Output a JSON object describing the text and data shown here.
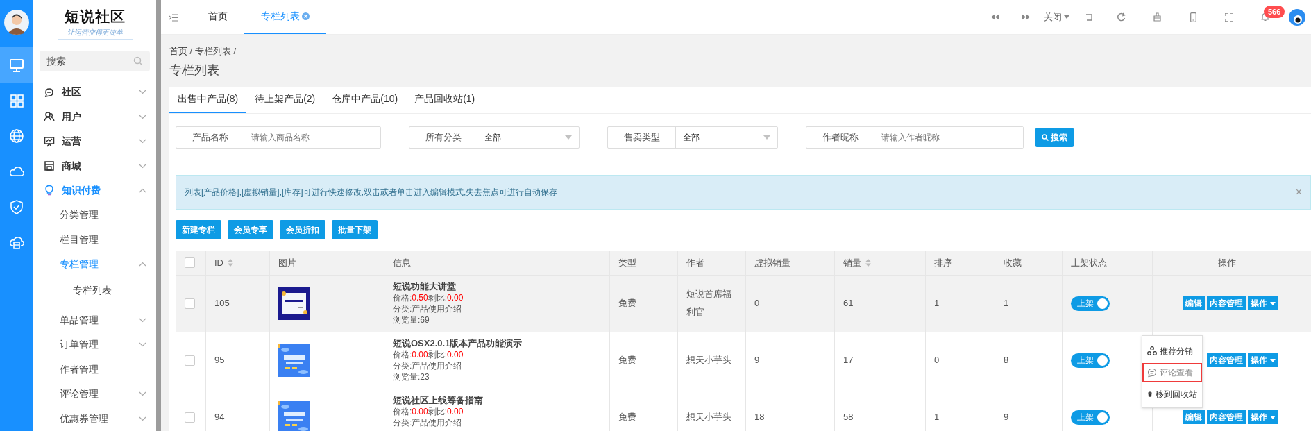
{
  "rail": {
    "items": [
      {
        "kind": "monitor",
        "selected": true
      },
      {
        "kind": "grid",
        "selected": false
      },
      {
        "kind": "globe",
        "selected": false
      },
      {
        "kind": "cloud",
        "selected": false
      },
      {
        "kind": "shield",
        "selected": false
      },
      {
        "kind": "storage",
        "selected": false
      }
    ]
  },
  "sidebar": {
    "logo": "短说社区",
    "slogan": "让运营变得更简单",
    "search": {
      "placeholder": "搜索"
    },
    "items": [
      {
        "kind": "chat",
        "label": "社区",
        "expanded": false,
        "selected": false
      },
      {
        "kind": "users",
        "label": "用户",
        "expanded": false,
        "selected": false
      },
      {
        "kind": "board",
        "label": "运营",
        "expanded": false,
        "selected": false
      },
      {
        "kind": "store",
        "label": "商城",
        "expanded": false,
        "selected": false
      },
      {
        "kind": "bulb",
        "label": "知识付费",
        "expanded": true,
        "selected": true,
        "children": [
          {
            "label": "分类管理",
            "selected": false
          },
          {
            "label": "栏目管理",
            "selected": false
          },
          {
            "label": "专栏管理",
            "expanded": true,
            "selected": true,
            "children": [
              {
                "label": "专栏列表",
                "selected": false
              }
            ]
          },
          {
            "label": "单品管理",
            "expanded": false,
            "selected": false
          },
          {
            "label": "订单管理",
            "expanded": false,
            "selected": false
          },
          {
            "label": "作者管理",
            "selected": false
          },
          {
            "label": "评论管理",
            "expanded": false,
            "selected": false
          },
          {
            "label": "优惠券管理",
            "expanded": false,
            "selected": false
          }
        ]
      }
    ]
  },
  "topbar": {
    "tabs": [
      {
        "label": "首页",
        "selected": false,
        "closable": false
      },
      {
        "label": "专栏列表",
        "selected": true,
        "closable": true
      }
    ],
    "close_menu": "关闭",
    "notification_count": "566"
  },
  "breadcrumb": {
    "items": [
      "首页",
      "专栏列表"
    ],
    "separator": "/"
  },
  "page_title": "专栏列表",
  "product_tabs": [
    {
      "label": "出售中产品(8)",
      "selected": true
    },
    {
      "label": "待上架产品(2)",
      "selected": false
    },
    {
      "label": "仓库中产品(10)",
      "selected": false
    },
    {
      "label": "产品回收站(1)",
      "selected": false
    }
  ],
  "filters": [
    {
      "kind": "text",
      "label": "产品名称",
      "placeholder": "请输入商品名称"
    },
    {
      "kind": "select",
      "label": "所有分类",
      "value": "全部"
    },
    {
      "kind": "select",
      "label": "售卖类型",
      "value": "全部"
    },
    {
      "kind": "text",
      "label": "作者昵称",
      "placeholder": "请输入作者昵称"
    }
  ],
  "search_button": "搜索",
  "alert": {
    "text": "列表[产品价格],[虚拟销量],[库存]可进行快速修改,双击或者单击进入编辑模式,失去焦点可进行自动保存",
    "close": "×"
  },
  "action_buttons": [
    "新建专栏",
    "会员专享",
    "会员折扣",
    "批量下架"
  ],
  "table": {
    "header_checked": false,
    "columns": [
      {
        "label": "ID",
        "sortable": true
      },
      {
        "label": "图片",
        "sortable": false
      },
      {
        "label": "信息",
        "sortable": false
      },
      {
        "label": "类型",
        "sortable": false
      },
      {
        "label": "作者",
        "sortable": false
      },
      {
        "label": "虚拟销量",
        "sortable": false
      },
      {
        "label": "销量",
        "sortable": true
      },
      {
        "label": "排序",
        "sortable": false
      },
      {
        "label": "收藏",
        "sortable": false
      },
      {
        "label": "上架状态",
        "sortable": false
      },
      {
        "label": "操作",
        "sortable": false
      }
    ],
    "rows": [
      {
        "checked": false,
        "hovered": true,
        "id": "105",
        "title": "短说功能大讲堂",
        "price_label": "价格:",
        "price": "0.50",
        "ratio_label": "剥比:",
        "ratio": "0.00",
        "category": "分类:产品使用介绍",
        "views": "浏览量:69",
        "type": "免费",
        "author": "短说首席福利官",
        "virtual_sales": "0",
        "sales": "61",
        "sort": "1",
        "favorites": "1",
        "shelf": {
          "label": "上架",
          "on": true
        },
        "actions": [
          {
            "kind": "button",
            "label": "编辑"
          },
          {
            "kind": "button",
            "label": "内容管理"
          },
          {
            "kind": "dropdown",
            "label": "操作"
          }
        ]
      },
      {
        "checked": false,
        "hovered": false,
        "id": "95",
        "title": "短说OSX2.0.1版本产品功能演示",
        "price_label": "价格:",
        "price": "0.00",
        "ratio_label": "剥比:",
        "ratio": "0.00",
        "category": "分类:产品使用介绍",
        "views": "浏览量:23",
        "type": "免费",
        "author": "想天小芋头",
        "virtual_sales": "9",
        "sales": "17",
        "sort": "0",
        "favorites": "8",
        "shelf": {
          "label": "上架",
          "on": true
        },
        "actions": [
          {
            "kind": "button",
            "label": "内容管理"
          },
          {
            "kind": "dropdown",
            "label": "操作"
          }
        ]
      },
      {
        "checked": false,
        "hovered": false,
        "id": "94",
        "title": "短说社区上线筹备指南",
        "price_label": "价格:",
        "price": "0.00",
        "ratio_label": "剥比:",
        "ratio": "0.00",
        "category": "分类:产品使用介绍",
        "type": "免费",
        "author": "想天小芋头",
        "virtual_sales": "18",
        "sales": "58",
        "sort": "1",
        "favorites": "9",
        "shelf": {
          "label": "上架",
          "on": true
        },
        "actions": [
          {
            "kind": "button",
            "label": "编辑"
          },
          {
            "kind": "button",
            "label": "内容管理"
          },
          {
            "kind": "dropdown",
            "label": "操作"
          }
        ]
      }
    ]
  },
  "dropdown": {
    "items": [
      {
        "kind": "share",
        "label": "推荐分销",
        "selected": false
      },
      {
        "kind": "comment",
        "label": "评论查看",
        "selected": true
      },
      {
        "kind": "trash",
        "label": "移到回收站",
        "selected": false
      }
    ]
  }
}
